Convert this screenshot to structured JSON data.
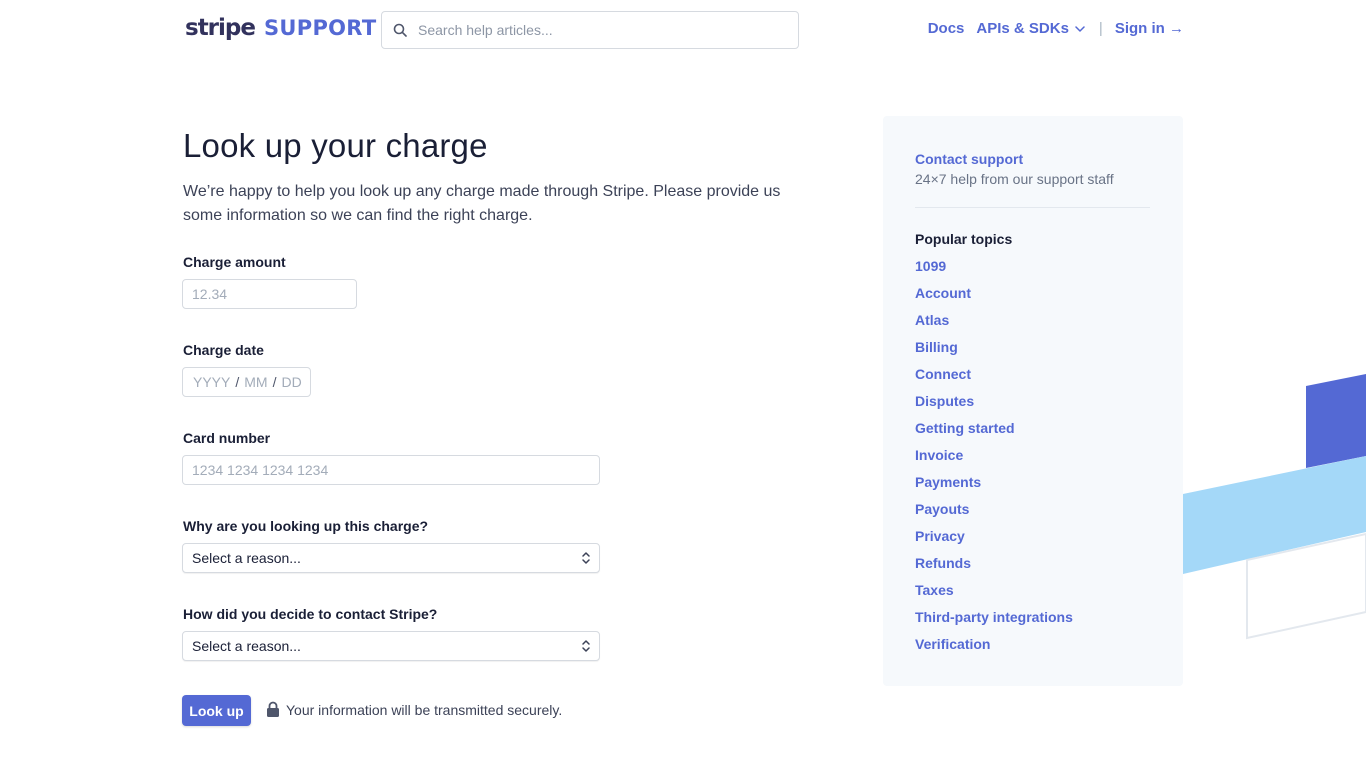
{
  "header": {
    "logo_main": "stripe",
    "logo_sub": "SUPPORT",
    "search_placeholder": "Search help articles...",
    "nav": {
      "docs": "Docs",
      "apis": "APIs & SDKs",
      "separator": "|",
      "sign_in": "Sign in →"
    }
  },
  "main": {
    "title": "Look up your charge",
    "intro": "We’re happy to help you look up any charge made through Stripe. Please provide us some information so we can find the right charge.",
    "fields": {
      "amount": {
        "label": "Charge amount",
        "placeholder": "12.34"
      },
      "date": {
        "label": "Charge date",
        "year": "YYYY",
        "month": "MM",
        "day": "DD",
        "separator": "/"
      },
      "card": {
        "label": "Card number",
        "placeholder": "1234 1234 1234 1234"
      },
      "reason": {
        "label": "Why are you looking up this charge?",
        "selected": "Select a reason..."
      },
      "contact_reason": {
        "label": "How did you decide to contact Stripe?",
        "selected": "Select a reason..."
      }
    },
    "submit_label": "Look up",
    "secure_note": "Your information will be transmitted securely."
  },
  "sidebar": {
    "contact_link": "Contact support",
    "contact_sub": "24×7 help from our support staff",
    "topics_title": "Popular topics",
    "topics": [
      "1099",
      "Account",
      "Atlas",
      "Billing",
      "Connect",
      "Disputes",
      "Getting started",
      "Invoice",
      "Payments",
      "Payouts",
      "Privacy",
      "Refunds",
      "Taxes",
      "Third-party integrations",
      "Verification"
    ]
  },
  "colors": {
    "brand": "#5469d4",
    "text": "#1a1f36",
    "sidebar_bg": "#f6f9fc",
    "stripe_light": "#a4d8f8",
    "stripe_dark": "#5469d4"
  },
  "icons": {
    "search": "search-icon",
    "chevron": "chevron-down-icon",
    "select_arrows": "select-arrows-icon",
    "lock": "lock-icon"
  }
}
